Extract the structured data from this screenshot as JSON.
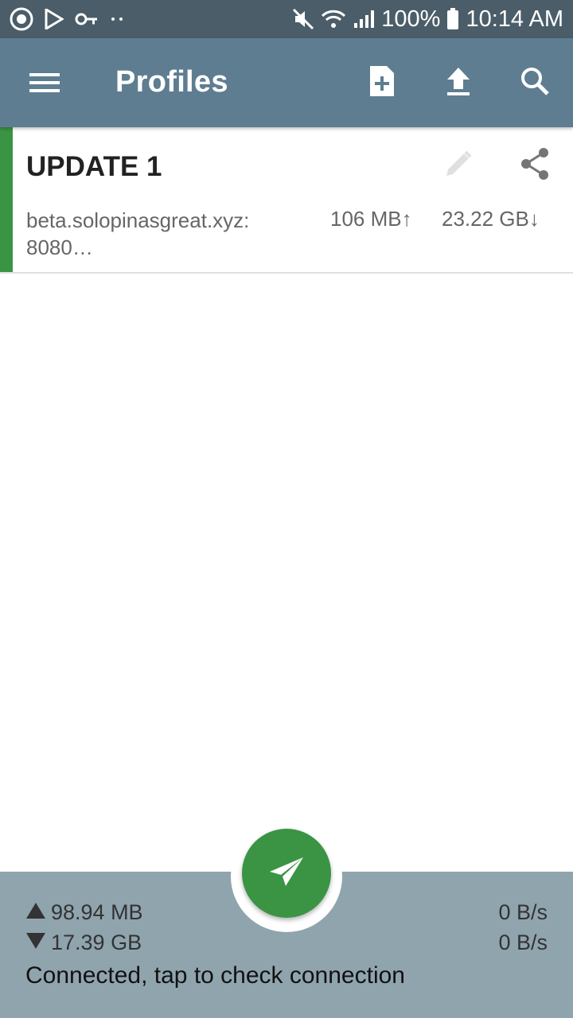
{
  "status_bar": {
    "battery": "100%",
    "time": "10:14 AM",
    "icons": [
      "vpn-shield-icon",
      "play-store-icon",
      "key-icon",
      "more-dots-icon",
      "mute-icon",
      "wifi-icon",
      "signal-icon",
      "battery-icon"
    ]
  },
  "app_bar": {
    "title": "Profiles",
    "actions": [
      "new-profile-icon",
      "import-icon",
      "search-icon"
    ]
  },
  "profile": {
    "name": "UPDATE 1",
    "host_line1": "beta.solopinasgreat.xyz:",
    "host_line2": "8080…",
    "upload": "106 MB↑",
    "download": "23.22 GB↓"
  },
  "bottom": {
    "sent_total": "98.94 MB",
    "received_total": "17.39 GB",
    "send_rate": "0 B/s",
    "receive_rate": "0 B/s",
    "status": "Connected, tap to check connection"
  },
  "colors": {
    "status_bar": "#4a5d69",
    "app_bar": "#5e7d91",
    "accent_green": "#3a9444",
    "bottom_bar": "#90a4ae"
  }
}
